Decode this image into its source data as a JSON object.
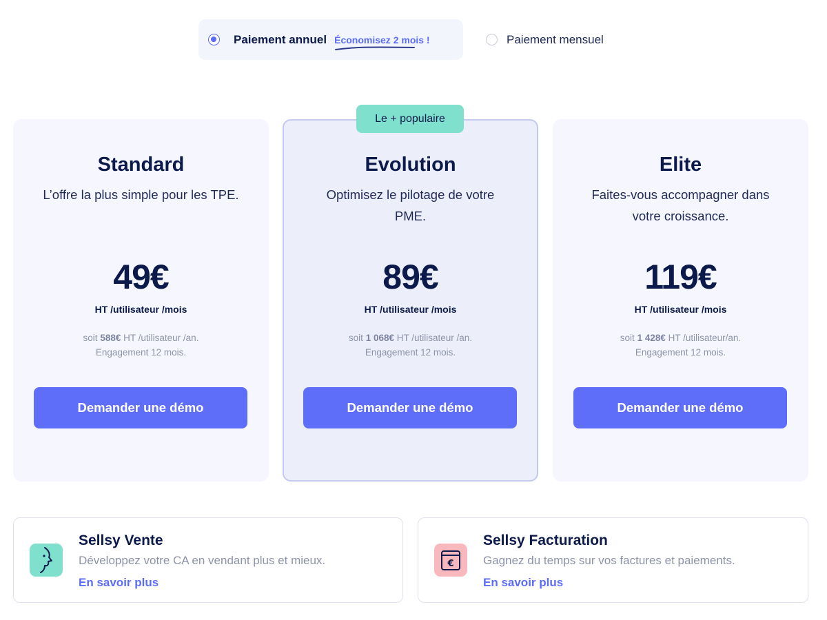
{
  "billing": {
    "annual_label": "Paiement annuel",
    "annual_savings": "Économisez 2 mois !",
    "monthly_label": "Paiement mensuel",
    "selected": "annual"
  },
  "popular_badge": "Le + populaire",
  "plans": [
    {
      "name": "Standard",
      "description": "L’offre la plus simple pour les TPE.",
      "price": "49€",
      "price_unit": "HT /utilisateur /mois",
      "annual_prefix": "soit",
      "annual_amount": "588€",
      "annual_suffix": "HT /utilisateur /an.",
      "commitment": "Engagement 12 mois.",
      "cta": "Demander une démo"
    },
    {
      "name": "Evolution",
      "description": "Optimisez le pilotage de votre PME.",
      "price": "89€",
      "price_unit": "HT /utilisateur /mois",
      "annual_prefix": "soit",
      "annual_amount": "1 068€",
      "annual_suffix": "HT /utilisateur /an.",
      "commitment": "Engagement 12 mois.",
      "cta": "Demander une démo"
    },
    {
      "name": "Elite",
      "description": "Faites-vous accompagner dans votre croissance.",
      "price": "119€",
      "price_unit": "HT /utilisateur /mois",
      "annual_prefix": "soit",
      "annual_amount": "1 428€",
      "annual_suffix": "HT /utilisateur/an.",
      "commitment": "Engagement 12 mois.",
      "cta": "Demander une démo"
    }
  ],
  "products": [
    {
      "title": "Sellsy Vente",
      "description": "Développez votre CA en vendant plus et mieux.",
      "link": "En savoir plus",
      "icon": "face-profile-icon"
    },
    {
      "title": "Sellsy Facturation",
      "description": "Gagnez du temps sur vos factures et paiements.",
      "link": "En savoir plus",
      "icon": "euro-invoice-icon"
    }
  ],
  "colors": {
    "accent": "#5f6ef9",
    "text_dark": "#0c1a4b",
    "badge": "#7fe0cd",
    "vente_icon_bg": "#7fe0cd",
    "facturation_icon_bg": "#f9b8bd"
  }
}
